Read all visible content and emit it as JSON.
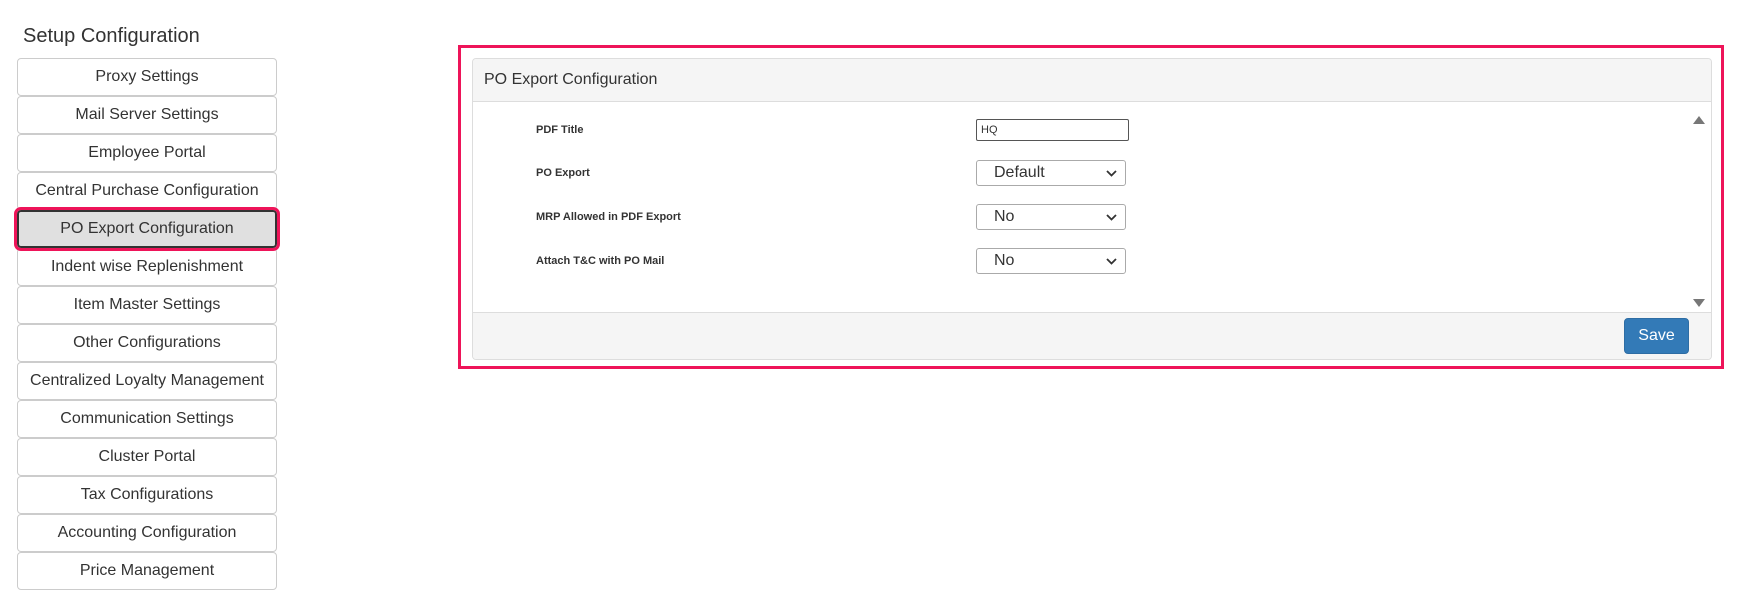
{
  "sidebar": {
    "title": "Setup Configuration",
    "items": [
      {
        "label": "Proxy Settings"
      },
      {
        "label": "Mail Server Settings"
      },
      {
        "label": "Employee Portal"
      },
      {
        "label": "Central Purchase Configuration"
      },
      {
        "label": "PO Export Configuration",
        "active": true
      },
      {
        "label": "Indent wise Replenishment"
      },
      {
        "label": "Item Master Settings"
      },
      {
        "label": "Other Configurations"
      },
      {
        "label": "Centralized Loyalty Management"
      },
      {
        "label": "Communication Settings"
      },
      {
        "label": "Cluster Portal"
      },
      {
        "label": "Tax Configurations"
      },
      {
        "label": "Accounting Configuration"
      },
      {
        "label": "Price Management"
      }
    ]
  },
  "panel": {
    "title": "PO Export Configuration",
    "fields": {
      "pdf_title": {
        "label": "PDF Title",
        "value": "HQ"
      },
      "po_export": {
        "label": "PO Export",
        "value": "Default"
      },
      "mrp_allowed": {
        "label": "MRP Allowed in PDF Export",
        "value": "No"
      },
      "attach_tc": {
        "label": "Attach T&C with PO Mail",
        "value": "No"
      }
    },
    "save_label": "Save"
  },
  "colors": {
    "highlight": "#ee1459",
    "primary_button": "#337ab7",
    "active_item_bg": "#e0e0e0"
  },
  "icons": {
    "select_arrow": "chevron-down-icon",
    "scroll_up": "triangle-up-icon",
    "scroll_down": "triangle-down-icon"
  }
}
